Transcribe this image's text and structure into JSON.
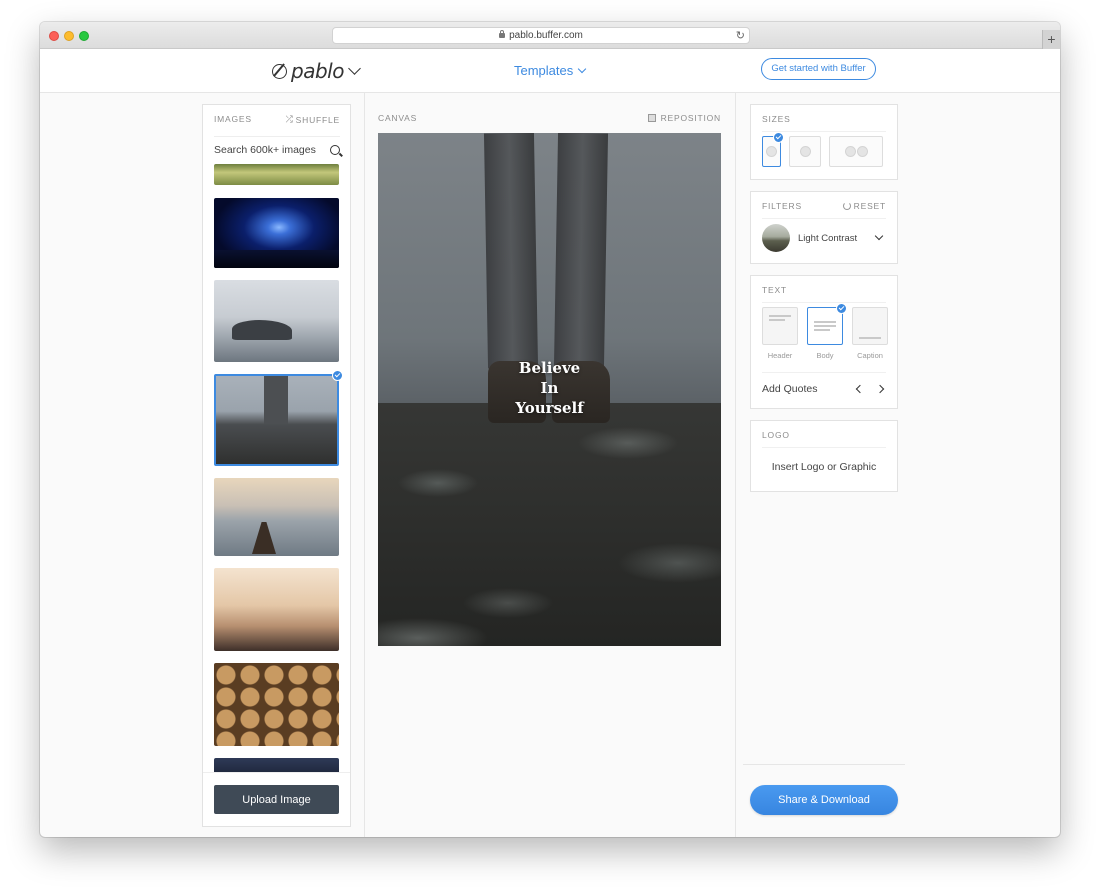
{
  "browser": {
    "url": "pablo.buffer.com"
  },
  "header": {
    "logo_text": "pablo",
    "templates_label": "Templates",
    "get_started_label": "Get started with Buffer"
  },
  "images_panel": {
    "title": "IMAGES",
    "shuffle_label": "SHUFFLE",
    "search_placeholder": "Search 600k+ images",
    "upload_label": "Upload Image",
    "selected_index": 3
  },
  "canvas": {
    "title": "CANVAS",
    "reposition_label": "REPOSITION",
    "quote_lines": [
      "Believe",
      "In",
      "Yourself"
    ]
  },
  "sizes": {
    "title": "SIZES",
    "selected": "pinterest"
  },
  "filters": {
    "title": "FILTERS",
    "reset_label": "RESET",
    "current": "Light Contrast"
  },
  "text": {
    "title": "TEXT",
    "options": [
      "Header",
      "Body",
      "Caption"
    ],
    "selected": "Body",
    "add_quotes_label": "Add Quotes"
  },
  "logo": {
    "title": "LOGO",
    "insert_label": "Insert Logo or Graphic"
  },
  "share_label": "Share & Download",
  "colors": {
    "accent": "#3d8ae0",
    "upload_button": "#3f4a56"
  }
}
